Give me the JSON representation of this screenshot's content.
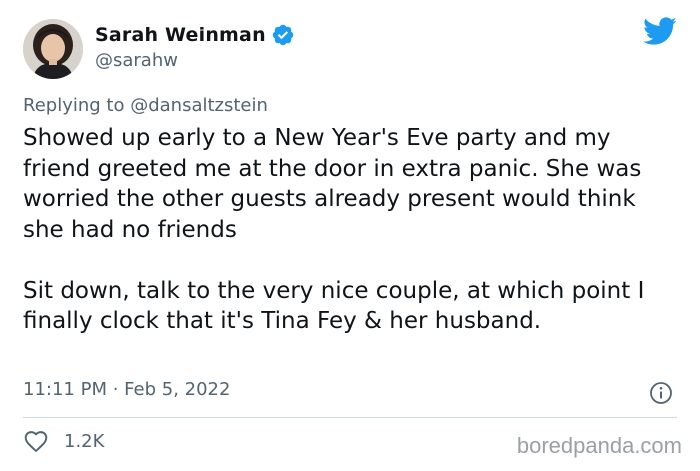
{
  "author": {
    "display_name": "Sarah Weinman",
    "handle": "@sarahw",
    "verified_icon": "verified-badge-icon",
    "avatar_icon": "avatar-photo"
  },
  "platform_icon": "twitter-bird-icon",
  "reply": {
    "prefix": "Replying to",
    "to_handle": "@dansaltzstein"
  },
  "tweet": {
    "paragraphs": [
      "Showed up early to a New Year's Eve party and my friend greeted me at the door in extra panic. She was worried the other guests already present would think she had no friends",
      "Sit down, talk to the very nice couple, at which point I finally clock that it's Tina Fey & her husband."
    ],
    "timestamp": "11:11 PM · Feb 5, 2022"
  },
  "actions": {
    "like_count": "1.2K",
    "like_icon": "heart-icon",
    "info_icon": "info-icon"
  },
  "watermark": "boredpanda.com",
  "colors": {
    "text_primary": "#0f1419",
    "text_secondary": "#536471",
    "twitter_blue": "#1d9bf0",
    "divider": "#cfd9de",
    "watermark": "#9aa0a6"
  }
}
